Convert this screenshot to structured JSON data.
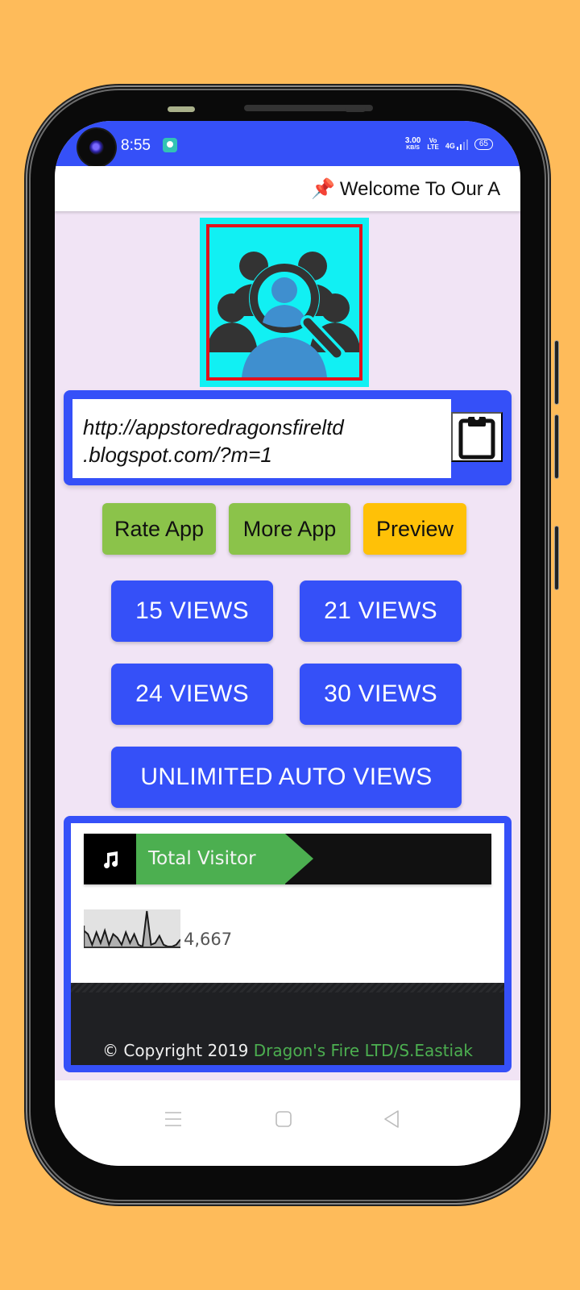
{
  "status_bar": {
    "time": "8:55",
    "net_speed_value": "3.00",
    "net_speed_unit": "KB/S",
    "volte_top": "Vo",
    "volte_bottom": "LTE",
    "network_type": "4G",
    "battery_level": "65"
  },
  "marquee": {
    "pin_icon": "📌",
    "text": "Welcome To Our A"
  },
  "logo": {
    "icon": "people-search-icon"
  },
  "url_field": {
    "value_line1": "http://appstoredragonsfireltd",
    "value_line2": ".blogspot.com/?m=1",
    "clipboard_icon": "clipboard-icon"
  },
  "actions": {
    "rate_app": "Rate App",
    "more_app": "More App",
    "preview": "Preview"
  },
  "views": {
    "v15": "15 VIEWS",
    "v21": "21 VIEWS",
    "v24": "24 VIEWS",
    "v30": "30 VIEWS",
    "unlimited": "UNLIMITED AUTO VIEWS"
  },
  "visitor_widget": {
    "title": "Total Visitor",
    "icon": "music-note-icon",
    "count": "4,667",
    "sparkline": [
      0.45,
      0.35,
      0.05,
      0.4,
      0.1,
      0.45,
      0.05,
      0.35,
      0.25,
      0.05,
      0.4,
      0.1,
      0.35,
      0.05,
      0.0,
      1.0,
      0.05,
      0.1,
      0.3,
      0.05,
      0.0,
      0.0,
      0.05,
      0.2
    ]
  },
  "footer": {
    "copyright_prefix": "© Copyright 2019 ",
    "brand": "Dragon's Fire LTD/S.Eastiak"
  },
  "colors": {
    "primary_blue": "#3550F8",
    "green": "#8BC34A",
    "amber": "#FFC107",
    "visitor_green": "#4CAF50",
    "background": "#F1E4F5",
    "page_bg": "#FEBB5A"
  }
}
